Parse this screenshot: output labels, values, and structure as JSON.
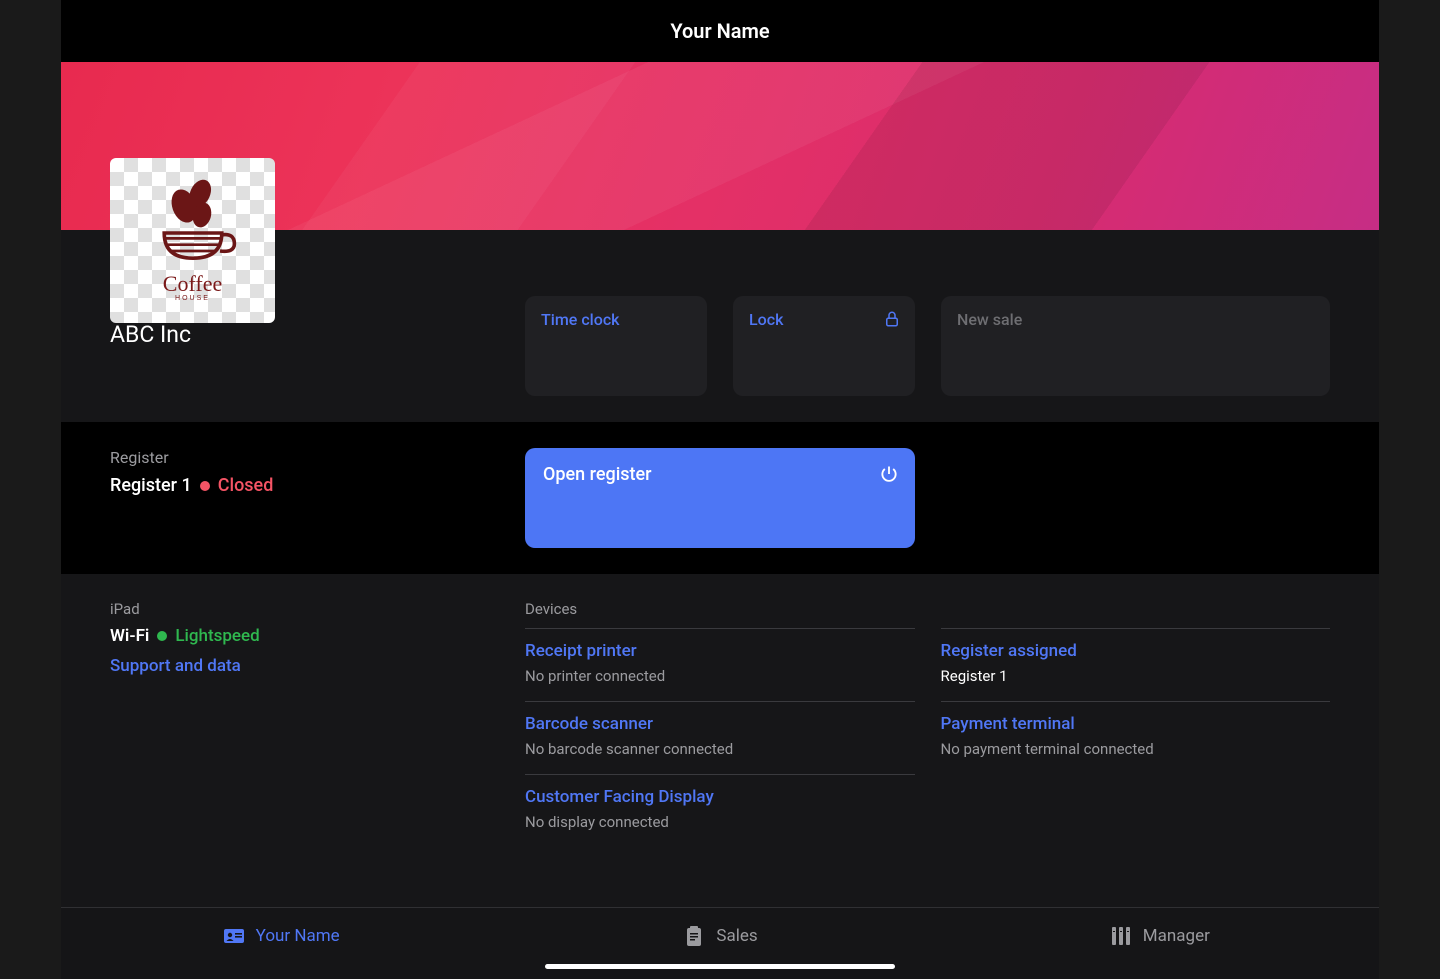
{
  "header": {
    "title": "Your Name"
  },
  "logo": {
    "text": "Coffee",
    "subtext": "HOUSE"
  },
  "company": {
    "label": "ABC Inc",
    "name": "ABC Inc"
  },
  "actions": {
    "time_clock": "Time clock",
    "lock": "Lock",
    "new_sale": "New sale"
  },
  "register": {
    "label": "Register",
    "name": "Register 1",
    "status": "Closed",
    "open_button": "Open register"
  },
  "ipad": {
    "label": "iPad",
    "wifi_label": "Wi-Fi",
    "wifi_name": "Lightspeed",
    "support_link": "Support and data"
  },
  "devices": {
    "header": "Devices",
    "col1": [
      {
        "title": "Receipt printer",
        "status": "No printer connected"
      },
      {
        "title": "Barcode scanner",
        "status": "No barcode scanner connected"
      },
      {
        "title": "Customer Facing Display",
        "status": "No display connected"
      }
    ],
    "col2": [
      {
        "title": "Register assigned",
        "status": "Register 1",
        "white": true
      },
      {
        "title": "Payment terminal",
        "status": "No payment terminal connected"
      }
    ]
  },
  "nav": {
    "your_name": "Your Name",
    "sales": "Sales",
    "manager": "Manager"
  }
}
